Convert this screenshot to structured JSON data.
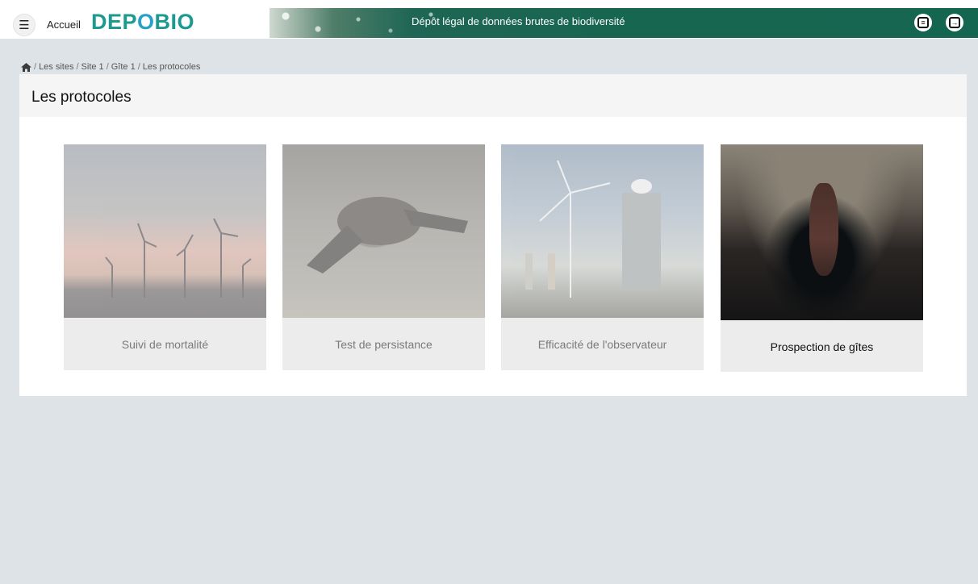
{
  "header": {
    "menu_icon": "hamburger-icon",
    "home_label": "Accueil",
    "logo_text_a": "DEP",
    "logo_text_o": "O",
    "logo_text_b": "BIO",
    "banner_title": "Dépôt légal de données brutes de biodiversité",
    "right_icons": [
      "document-icon",
      "logout-icon"
    ]
  },
  "breadcrumb": {
    "home_icon": "home-icon",
    "items": [
      "Les sites",
      "Site 1",
      "Gîte 1",
      "Les protocoles"
    ],
    "separator": "/"
  },
  "page": {
    "title": "Les protocoles"
  },
  "protocols": [
    {
      "label": "Suivi de mortalité",
      "image": "wind-turbines-sunset",
      "state": "inactive"
    },
    {
      "label": "Test de persistance",
      "image": "bat-on-rock",
      "state": "inactive"
    },
    {
      "label": "Efficacité de l'observateur",
      "image": "observer-near-turbine",
      "state": "inactive"
    },
    {
      "label": "Prospection de gîtes",
      "image": "bat-in-cave",
      "state": "active"
    }
  ],
  "colors": {
    "background": "#dde3e6",
    "banner": "#176650",
    "logo_teal": "#1c9a92",
    "logo_blue": "#27a0c8"
  }
}
